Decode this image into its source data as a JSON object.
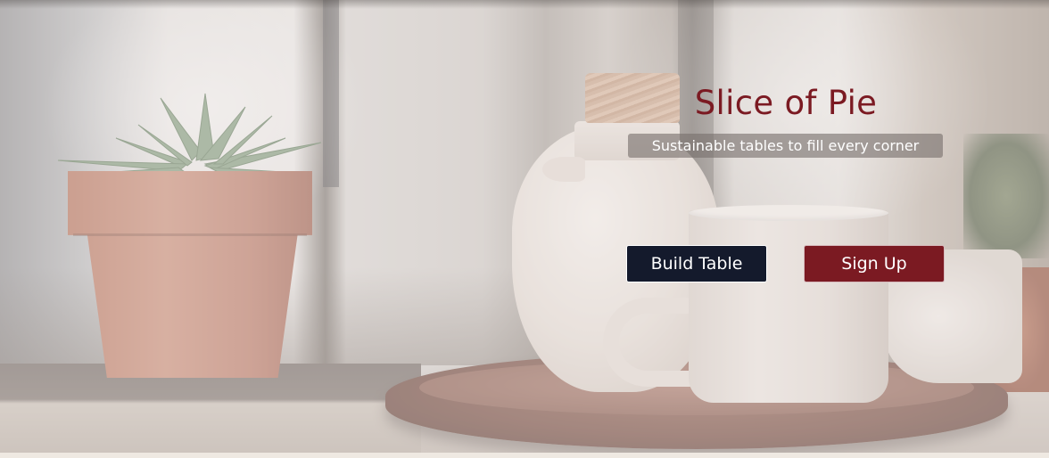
{
  "hero": {
    "title": "Slice of Pie",
    "tagline": "Sustainable tables to fill every corner",
    "background_image": "succulent-teapot-mug-photo"
  },
  "actions": {
    "build_label": "Build Table",
    "signup_label": "Sign Up"
  },
  "colors": {
    "brand": "#7b1a22",
    "build_button": "#141a2c",
    "signup_button": "#7b1a22",
    "tagline_bg": "#78706c"
  }
}
